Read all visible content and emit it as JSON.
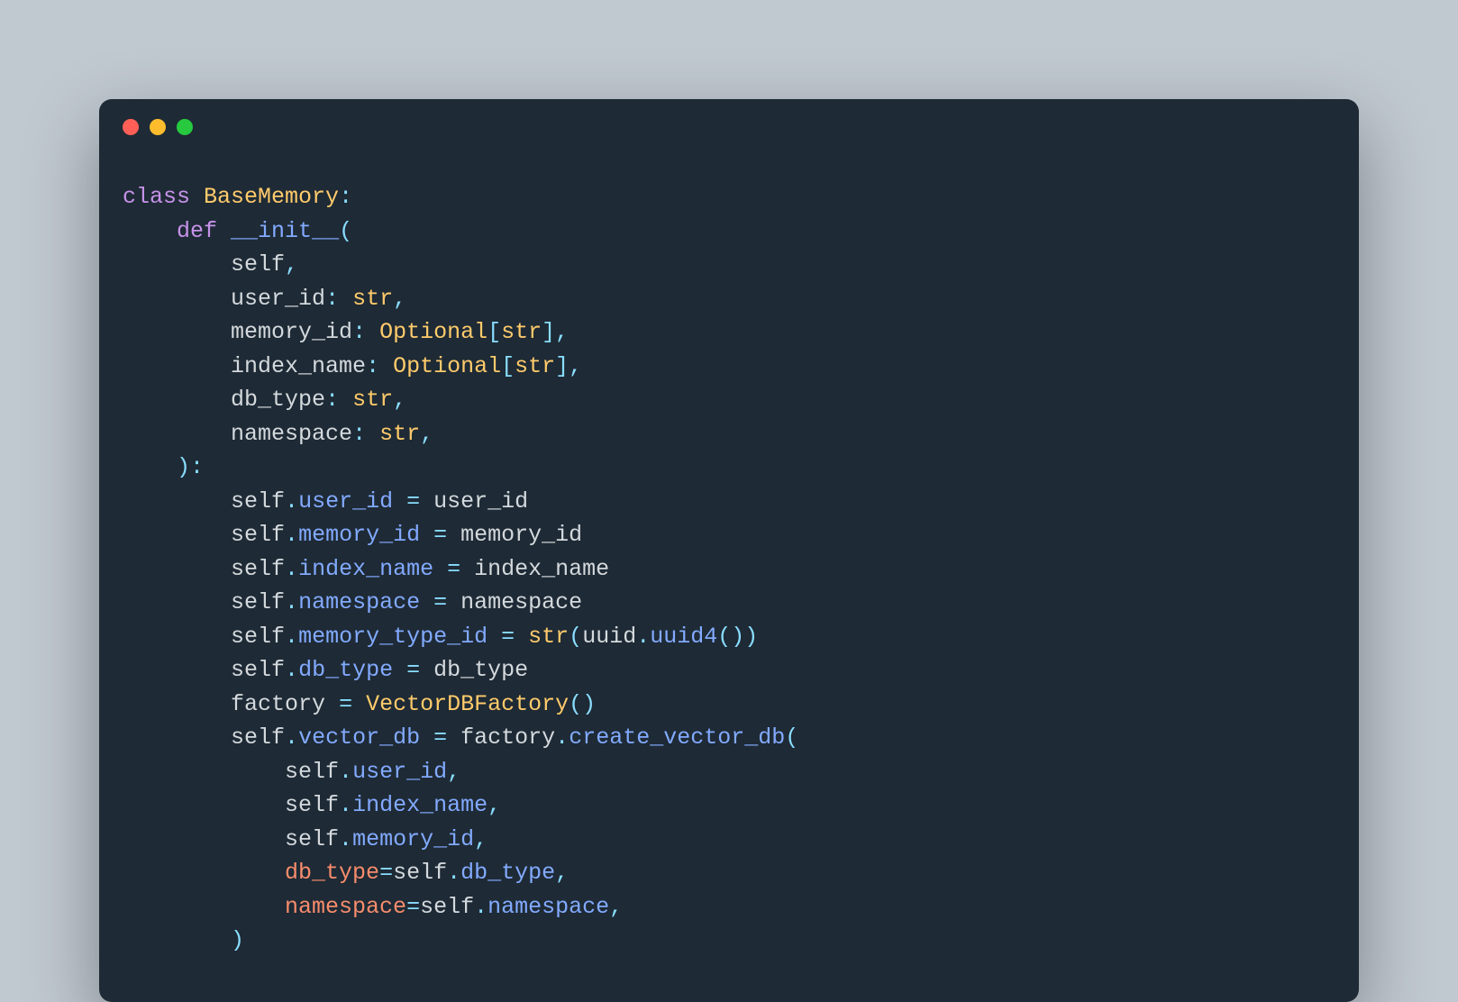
{
  "window": {
    "traffic_lights": [
      "close",
      "minimize",
      "zoom"
    ]
  },
  "code": {
    "class_keyword": "class",
    "class_name": "BaseMemory",
    "def_keyword": "def",
    "init_name": "__init__",
    "params": {
      "self": "self",
      "user_id": "user_id",
      "user_id_type": "str",
      "memory_id": "memory_id",
      "memory_id_type_outer": "Optional",
      "memory_id_type_inner": "str",
      "index_name": "index_name",
      "index_name_type_outer": "Optional",
      "index_name_type_inner": "str",
      "db_type": "db_type",
      "db_type_type": "str",
      "namespace": "namespace",
      "namespace_type": "str"
    },
    "body": {
      "l1_self": "self",
      "l1_attr": "user_id",
      "l1_rhs": "user_id",
      "l2_self": "self",
      "l2_attr": "memory_id",
      "l2_rhs": "memory_id",
      "l3_self": "self",
      "l3_attr": "index_name",
      "l3_rhs": "index_name",
      "l4_self": "self",
      "l4_attr": "namespace",
      "l4_rhs": "namespace",
      "l5_self": "self",
      "l5_attr": "memory_type_id",
      "l5_builtin": "str",
      "l5_mod": "uuid",
      "l5_fn": "uuid4",
      "l6_self": "self",
      "l6_attr": "db_type",
      "l6_rhs": "db_type",
      "l7_var": "factory",
      "l7_cls": "VectorDBFactory",
      "l8_self": "self",
      "l8_attr": "vector_db",
      "l8_obj": "factory",
      "l8_method": "create_vector_db",
      "l9_self": "self",
      "l9_attr": "user_id",
      "l10_self": "self",
      "l10_attr": "index_name",
      "l11_self": "self",
      "l11_attr": "memory_id",
      "l12_kw": "db_type",
      "l12_self": "self",
      "l12_attr": "db_type",
      "l13_kw": "namespace",
      "l13_self": "self",
      "l13_attr": "namespace"
    }
  }
}
